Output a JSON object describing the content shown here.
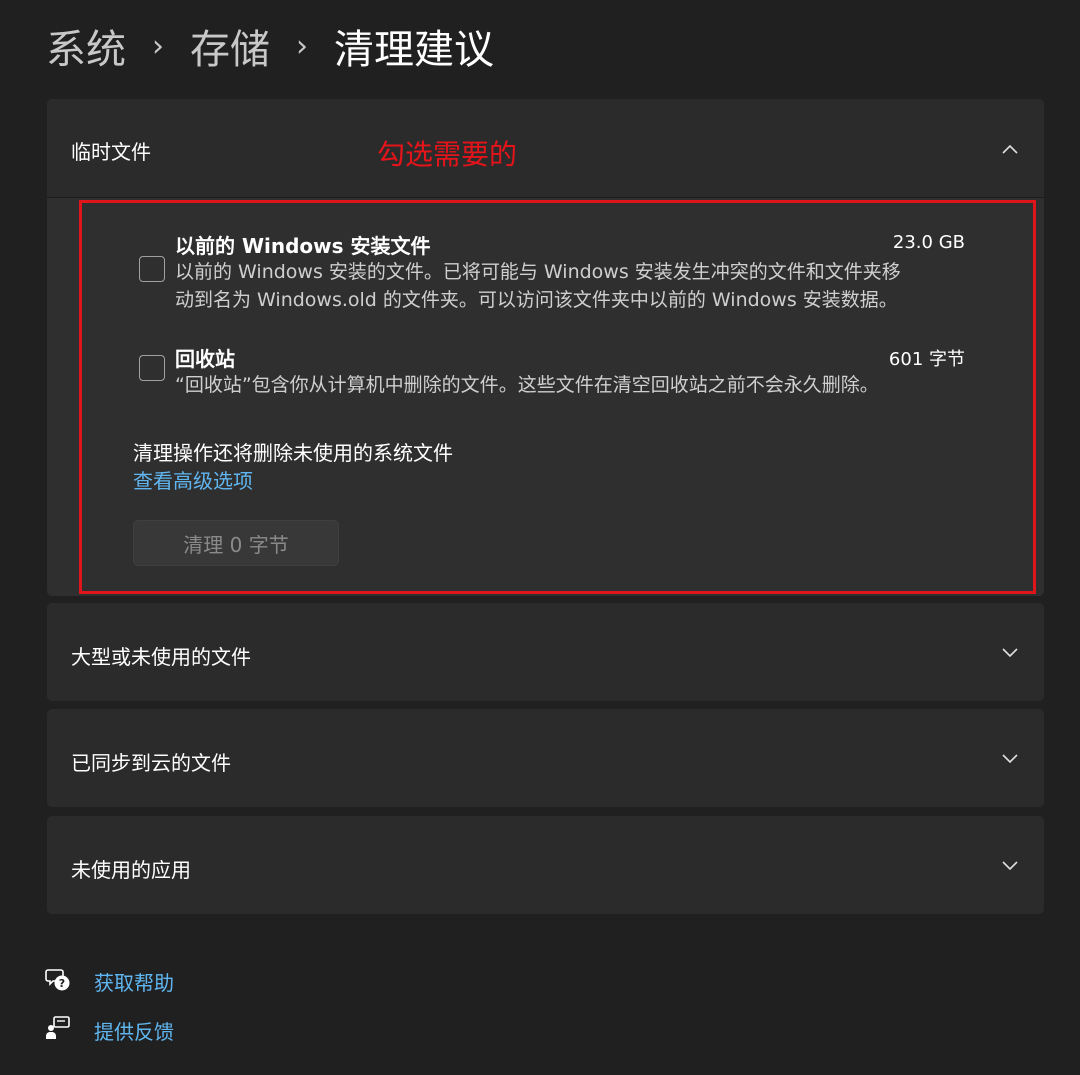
{
  "breadcrumb": {
    "items": [
      "系统",
      "存储",
      "清理建议"
    ],
    "separator": "›"
  },
  "annotation": {
    "text": "勾选需要的",
    "color": "#e5141a"
  },
  "temp_files": {
    "title": "临时文件",
    "expanded": true,
    "items": [
      {
        "title": "以前的 Windows 安装文件",
        "size": "23.0 GB",
        "desc_line1": "以前的 Windows 安装的文件。已将可能与 Windows 安装发生冲突的文件和文件夹移",
        "desc_line2": "动到名为 Windows.old 的文件夹。可以访问该文件夹中以前的 Windows 安装数据。",
        "checked": false
      },
      {
        "title": "回收站",
        "size": "601 字节",
        "desc_line1": "“回收站”包含你从计算机中删除的文件。这些文件在清空回收站之前不会永久删除。",
        "checked": false
      }
    ],
    "note": "清理操作还将删除未使用的系统文件",
    "advanced_link": "查看高级选项",
    "clean_button": "清理 0 字节"
  },
  "sections": [
    {
      "title": "大型或未使用的文件"
    },
    {
      "title": "已同步到云的文件"
    },
    {
      "title": "未使用的应用"
    }
  ],
  "footer": {
    "help": "获取帮助",
    "feedback": "提供反馈"
  },
  "colors": {
    "background": "#202020",
    "card": "#2b2b2b",
    "accent_link": "#60b6f0",
    "highlight": "#e0141b"
  }
}
